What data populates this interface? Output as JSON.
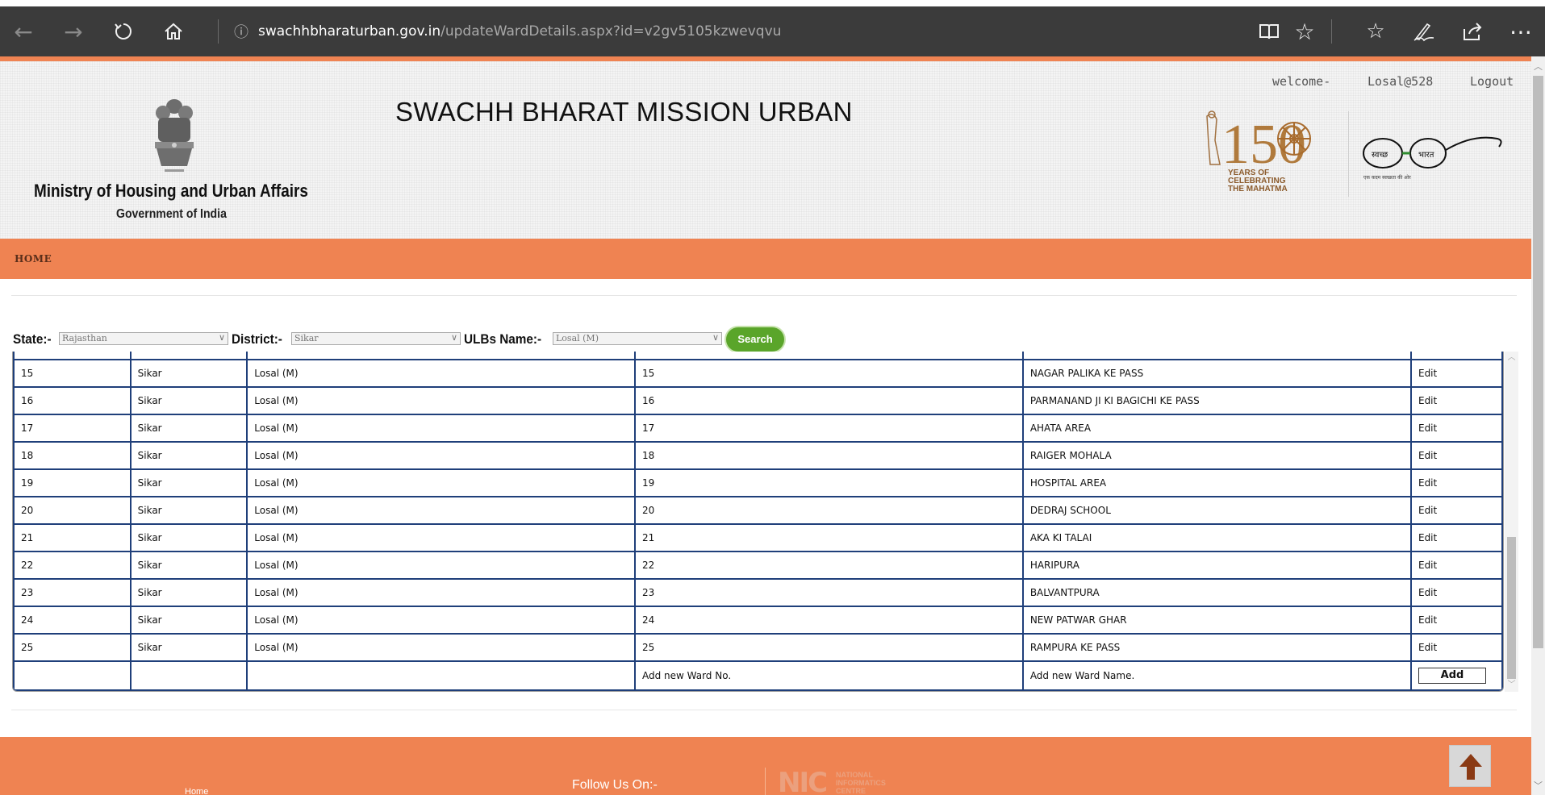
{
  "browser": {
    "url_host": "swachhbharaturban.gov.in",
    "url_path": "/updateWardDetails.aspx?id=v2gv5105kzwevqvu",
    "icons": [
      "back-icon",
      "forward-icon",
      "refresh-icon",
      "home-icon",
      "info-icon",
      "reading-view-icon",
      "favorite-star-icon",
      "favorites-list-icon",
      "pen-icon",
      "share-icon",
      "more-icon"
    ]
  },
  "header": {
    "ministry": "Ministry of Housing and Urban Affairs",
    "government": "Government of India",
    "title": "SWACHH BHARAT MISSION URBAN",
    "welcome_label": "welcome-",
    "username": "Losal@528",
    "logout_label": "Logout",
    "logo150_text": [
      "YEARS OF",
      "CELEBRATING",
      "THE MAHATMA"
    ],
    "logo150_number": "150",
    "sbm_left": "स्वच्छ",
    "sbm_right": "भारत",
    "sbm_tagline": "एक कदम स्वच्छता की ओर"
  },
  "nav": {
    "home_label": "HOME"
  },
  "filters": {
    "state_label": "State:-",
    "state_value": "Rajasthan",
    "district_label": "District:-",
    "district_value": "Sikar",
    "ulb_label": "ULBs Name:-",
    "ulb_value": "Losal (M)",
    "search_label": "Search"
  },
  "table": {
    "rows": [
      {
        "sno": "15",
        "district": "Sikar",
        "ulb": "Losal (M)",
        "ward_no": "15",
        "ward_name": "NAGAR PALIKA KE PASS",
        "action": "Edit"
      },
      {
        "sno": "16",
        "district": "Sikar",
        "ulb": "Losal (M)",
        "ward_no": "16",
        "ward_name": "PARMANAND JI KI BAGICHI KE PASS",
        "action": "Edit"
      },
      {
        "sno": "17",
        "district": "Sikar",
        "ulb": "Losal (M)",
        "ward_no": "17",
        "ward_name": "AHATA AREA",
        "action": "Edit"
      },
      {
        "sno": "18",
        "district": "Sikar",
        "ulb": "Losal (M)",
        "ward_no": "18",
        "ward_name": "RAIGER MOHALA",
        "action": "Edit"
      },
      {
        "sno": "19",
        "district": "Sikar",
        "ulb": "Losal (M)",
        "ward_no": "19",
        "ward_name": "HOSPITAL AREA",
        "action": "Edit"
      },
      {
        "sno": "20",
        "district": "Sikar",
        "ulb": "Losal (M)",
        "ward_no": "20",
        "ward_name": "DEDRAJ SCHOOL",
        "action": "Edit"
      },
      {
        "sno": "21",
        "district": "Sikar",
        "ulb": "Losal (M)",
        "ward_no": "21",
        "ward_name": "AKA KI TALAI",
        "action": "Edit"
      },
      {
        "sno": "22",
        "district": "Sikar",
        "ulb": "Losal (M)",
        "ward_no": "22",
        "ward_name": "HARIPURA",
        "action": "Edit"
      },
      {
        "sno": "23",
        "district": "Sikar",
        "ulb": "Losal (M)",
        "ward_no": "23",
        "ward_name": "BALVANTPURA",
        "action": "Edit"
      },
      {
        "sno": "24",
        "district": "Sikar",
        "ulb": "Losal (M)",
        "ward_no": "24",
        "ward_name": "NEW PATWAR GHAR",
        "action": "Edit"
      },
      {
        "sno": "25",
        "district": "Sikar",
        "ulb": "Losal (M)",
        "ward_no": "25",
        "ward_name": "RAMPURA KE PASS",
        "action": "Edit"
      }
    ],
    "add_row": {
      "ward_no_placeholder": "Add new Ward No.",
      "ward_name_placeholder": "Add new Ward Name.",
      "add_label": "Add"
    }
  },
  "footer": {
    "home_link": "Home",
    "follow_label": "Follow Us On:-",
    "nic_logo_text": "NIC",
    "nic_lines": [
      "NATIONAL",
      "INFORMATICS",
      "CENTRE"
    ]
  },
  "colors": {
    "accent_orange": "#ef8352",
    "search_green": "#5aa52a",
    "table_border": "#1f3f7a",
    "browser_chrome": "#3b3b3b"
  }
}
